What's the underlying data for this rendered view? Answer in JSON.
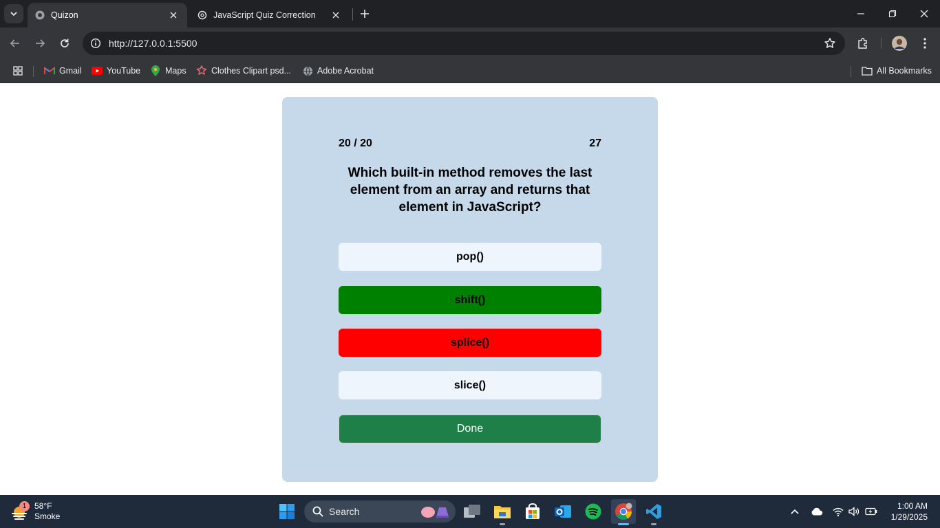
{
  "browser": {
    "tabs": [
      {
        "title": "Quizon",
        "active": true
      },
      {
        "title": "JavaScript Quiz Correction",
        "active": false
      }
    ],
    "url": "http://127.0.0.1:5500",
    "bookmarks": [
      {
        "label": "Gmail",
        "icon": "gmail-icon"
      },
      {
        "label": "YouTube",
        "icon": "youtube-icon"
      },
      {
        "label": "Maps",
        "icon": "maps-icon"
      },
      {
        "label": "Clothes Clipart psd...",
        "icon": "clothes-clipart-icon"
      },
      {
        "label": "Adobe Acrobat",
        "icon": "globe-icon"
      }
    ],
    "all_bookmarks_label": "All Bookmarks"
  },
  "quiz": {
    "counter": "20 / 20",
    "score": "27",
    "question": "Which built-in method removes the last element from an array and returns that element in JavaScript?",
    "options": [
      {
        "label": "pop()",
        "state": "neutral"
      },
      {
        "label": "shift()",
        "state": "correct"
      },
      {
        "label": "splice()",
        "state": "wrong"
      },
      {
        "label": "slice()",
        "state": "neutral"
      }
    ],
    "done_label": "Done",
    "colors": {
      "card": "#c5d9ea",
      "neutral": "#eef5fc",
      "correct": "#008000",
      "wrong": "#ff0000",
      "done": "#1e7f49"
    }
  },
  "taskbar": {
    "weather": {
      "temp": "58°F",
      "condition": "Smoke",
      "badge": "1"
    },
    "search_placeholder": "Search",
    "clock": {
      "time": "1:00 AM",
      "date": "1/29/2025"
    }
  }
}
